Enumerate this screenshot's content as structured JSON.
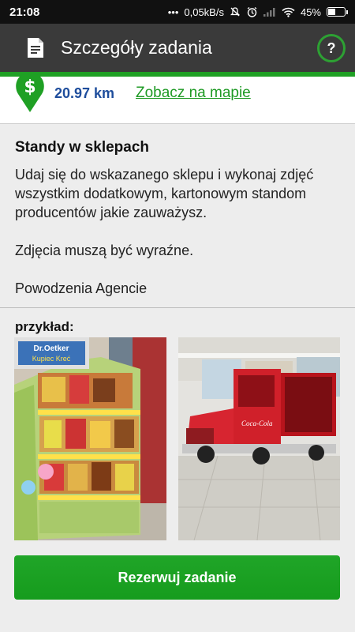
{
  "status": {
    "time": "21:08",
    "dots": "•••",
    "speed": "0,05kB/s",
    "battery": "45%",
    "battery_level": 0.45,
    "icons": [
      "mute-icon",
      "alarm-icon",
      "signal-icon",
      "wifi-icon",
      "battery-icon"
    ]
  },
  "header": {
    "title": "Szczegóły zadania",
    "help_label": "?",
    "icon": "document-icon",
    "accent_color": "#1fa024"
  },
  "location": {
    "distance": "20.97 km",
    "map_link": "Zobacz na mapie",
    "pin_symbol": "$"
  },
  "task": {
    "title": "Standy w sklepach",
    "paragraphs": [
      "Udaj się do wskazanego sklepu i wykonaj zdjęć wszystkim dodatkowym, kartonowym standom producentów jakie zauważysz.",
      "Zdjęcia muszą być wyraźne.",
      "Powodzenia Agencie"
    ]
  },
  "example": {
    "label": "przykład:",
    "left_photo_text": "Dr.Oetker",
    "left_photo_text2": "Kupiec Kreć",
    "right_photo_text": "Coca-Cola"
  },
  "actions": {
    "reserve_label": "Rezerwuj zadanie"
  }
}
